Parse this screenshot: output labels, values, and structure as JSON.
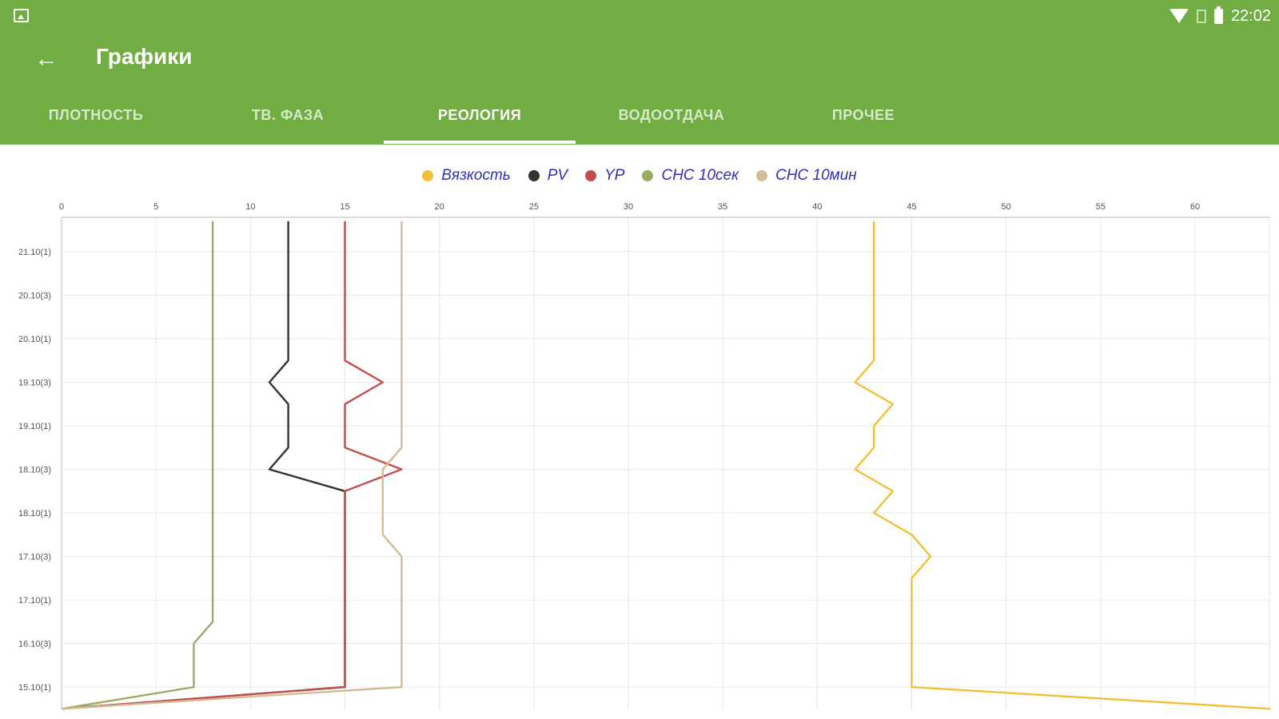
{
  "status_bar": {
    "time": "22:02",
    "icons": [
      "image-icon",
      "wifi-icon",
      "sim-icon",
      "battery-icon"
    ]
  },
  "toolbar": {
    "title": "Графики",
    "back_icon": "arrow-left-icon"
  },
  "tabs": [
    {
      "label": "ПЛОТНОСТЬ",
      "active": false
    },
    {
      "label": "ТВ. ФАЗА",
      "active": false
    },
    {
      "label": "РЕОЛОГИЯ",
      "active": true
    },
    {
      "label": "ВОДООТДАЧА",
      "active": false
    },
    {
      "label": "ПРОЧЕЕ",
      "active": false
    }
  ],
  "colors": {
    "appbar": "#72ad43",
    "legend_text": "#2f2fb5"
  },
  "chart_data": {
    "type": "line",
    "orientation": "horizontal-values",
    "x_ticks": [
      0,
      5,
      10,
      15,
      20,
      25,
      30,
      35,
      40,
      45,
      50,
      55,
      60
    ],
    "xlim": [
      0,
      64
    ],
    "categories": [
      "21.10(1)",
      "20.10(3)",
      "20.10(1)",
      "19.10(3)",
      "19.10(1)",
      "18.10(3)",
      "18.10(1)",
      "17.10(3)",
      "17.10(1)",
      "16.10(3)",
      "15.10(1)"
    ],
    "grid": true,
    "legend_position": "top-center",
    "series": [
      {
        "name": "Вязкость",
        "color": "#f2c037",
        "points": [
          [
            43,
            -0.7
          ],
          [
            43,
            2.5
          ],
          [
            42,
            3
          ],
          [
            44,
            3.5
          ],
          [
            43,
            4
          ],
          [
            43,
            4.5
          ],
          [
            42,
            5
          ],
          [
            44,
            5.5
          ],
          [
            43,
            6
          ],
          [
            45,
            6.5
          ],
          [
            46,
            7
          ],
          [
            45,
            7.5
          ],
          [
            45,
            10
          ],
          [
            64,
            10.5
          ]
        ]
      },
      {
        "name": "PV",
        "color": "#333333",
        "points": [
          [
            12,
            -0.7
          ],
          [
            12,
            2.5
          ],
          [
            11,
            3
          ],
          [
            12,
            3.5
          ],
          [
            12,
            4.5
          ],
          [
            11,
            5
          ],
          [
            15,
            5.5
          ],
          [
            15,
            10
          ],
          [
            0,
            10.5
          ]
        ]
      },
      {
        "name": "YP",
        "color": "#c0504d",
        "points": [
          [
            15,
            -0.7
          ],
          [
            15,
            2.5
          ],
          [
            17,
            3
          ],
          [
            15,
            3.5
          ],
          [
            15,
            4.5
          ],
          [
            18,
            5
          ],
          [
            15,
            5.5
          ],
          [
            15,
            10
          ],
          [
            0,
            10.5
          ]
        ]
      },
      {
        "name": "СНС 10сек",
        "color": "#9aab62",
        "points": [
          [
            8,
            -0.7
          ],
          [
            8,
            8.5
          ],
          [
            7,
            9
          ],
          [
            7,
            10
          ],
          [
            0,
            10.5
          ]
        ]
      },
      {
        "name": "СНС 10мин",
        "color": "#d3bc95",
        "points": [
          [
            18,
            -0.7
          ],
          [
            18,
            4.5
          ],
          [
            17,
            5
          ],
          [
            17,
            6.5
          ],
          [
            18,
            7
          ],
          [
            18,
            10
          ],
          [
            0,
            10.5
          ]
        ]
      }
    ]
  }
}
